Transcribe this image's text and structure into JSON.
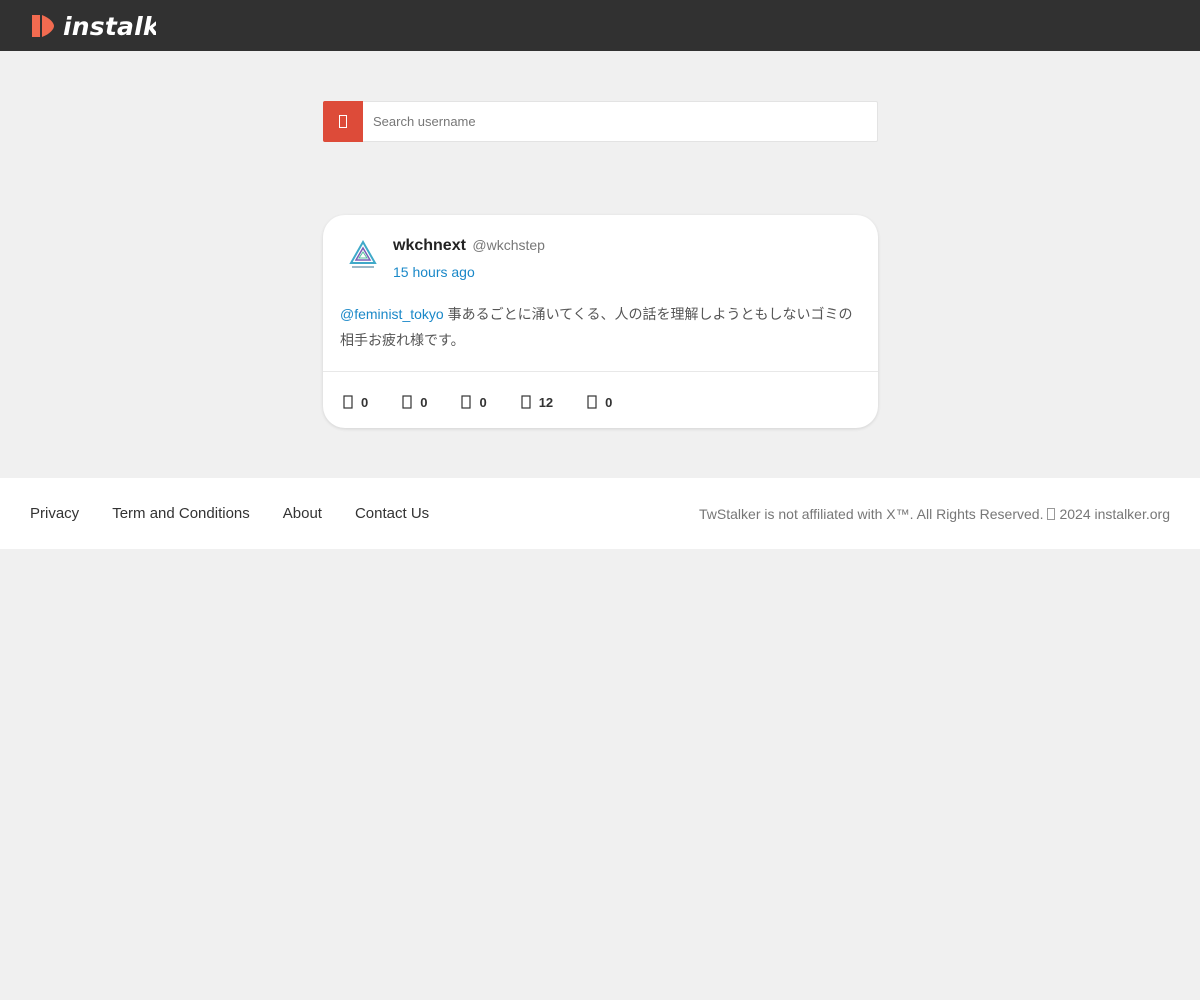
{
  "header": {
    "brand_text": "instalker",
    "brand_color": "#f26b50",
    "bar_color": "#313131"
  },
  "search": {
    "placeholder": "Search username",
    "button_icon": "search-icon",
    "button_color": "#dd4b39"
  },
  "tweet": {
    "display_name": "wkchnext",
    "handle": "@wkchstep",
    "time": "15 hours ago",
    "mention": "@feminist_tokyo",
    "text": " 事あるごとに涌いてくる、人の話を理解しようともしないゴミの相手お疲れ様です。",
    "stats": [
      {
        "icon": "reply-icon",
        "count": "0"
      },
      {
        "icon": "retweet-icon",
        "count": "0"
      },
      {
        "icon": "like-icon",
        "count": "0"
      },
      {
        "icon": "views-icon",
        "count": "12"
      },
      {
        "icon": "bookmark-icon",
        "count": "0"
      }
    ]
  },
  "footer": {
    "links": [
      "Privacy",
      "Term and Conditions",
      "About",
      "Contact Us"
    ],
    "copyright_prefix": "TwStalker is not affiliated with X™. All Rights Reserved.",
    "copyright_suffix": "2024 instalker.org"
  }
}
